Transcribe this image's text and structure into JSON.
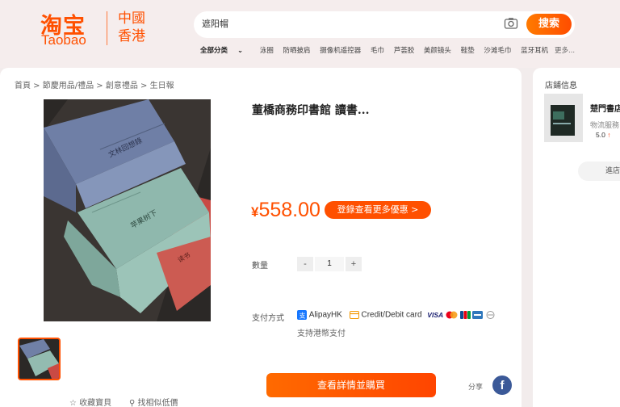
{
  "header": {
    "logo_cn": "淘宝",
    "logo_en": "Taobao",
    "region_line1": "中國",
    "region_line2": "香港",
    "search_value": "遮阳帽",
    "search_button": "搜索",
    "nav_items": [
      "全部分类",
      "泳圈",
      "防晒披肩",
      "摄像机遥控器",
      "毛巾",
      "芦荟胶",
      "美颜镜头",
      "鞋垫",
      "沙滩毛巾",
      "蓝牙耳机"
    ],
    "nav_more": "更多..."
  },
  "breadcrumb": "首頁 > 節慶用品/禮品 > 創意禮品 > 生日報",
  "product": {
    "title": "董橋商務印書館 讀書...",
    "currency": "¥",
    "price": "558.00",
    "coupon_button": "登錄查看更多優惠 >",
    "quantity_label": "數量",
    "quantity_minus": "-",
    "quantity_value": "1",
    "quantity_plus": "+",
    "payment_label": "支付方式",
    "payment_alipay": "AlipayHK",
    "payment_card": "Credit/Debit card",
    "payment_visa": "VISA",
    "payment_note": "支持港幣支付",
    "buy_button": "查看詳情並購買",
    "share_label": "分享",
    "favorite_label": "收藏寶貝",
    "similar_label": "找相似低價"
  },
  "store": {
    "heading": "店鋪信息",
    "name": "楚門書店",
    "service": "物流服務",
    "score": "5.0",
    "score_arrow": "↑",
    "button": "進店"
  },
  "colors": {
    "brand": "#ff5000",
    "facebook": "#3b5998"
  }
}
